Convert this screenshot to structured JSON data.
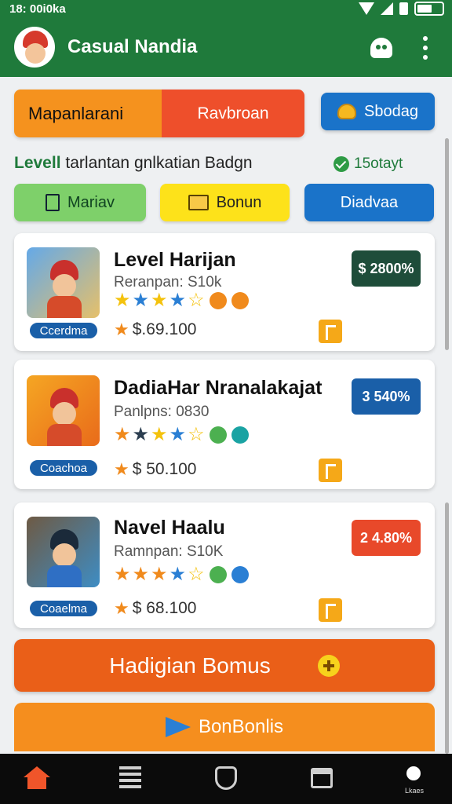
{
  "status_bar": {
    "time": "18: 00i0ka"
  },
  "app": {
    "title": "Casual Nandia"
  },
  "segment": {
    "left_label": "Mapanlarani",
    "right_label": "Ravbroan"
  },
  "top_button": {
    "label": "Sbodag"
  },
  "level_line": {
    "level": "Levell",
    "text": "tarlantan gnlkatian Badgn",
    "status": "15otayt"
  },
  "chips": [
    {
      "label": "Mariav"
    },
    {
      "label": "Bonun"
    },
    {
      "label": "Diadvaa"
    }
  ],
  "cards": [
    {
      "title": "Level Harijan",
      "subtitle": "Reranpan: S10k",
      "badge": "Ccerdma",
      "price": "$.69.100",
      "tag": "$ 2800%",
      "rating": 4
    },
    {
      "title": "DadiaHar Nranalakajat",
      "subtitle": "Panlpns: 0830",
      "badge": "Coachoa",
      "price": "$ 50.100",
      "tag": "3 540%",
      "rating": 4
    },
    {
      "title": "Navel Haalu",
      "subtitle": "Ramnpan: S10K",
      "badge": "Coaelma",
      "price": "$ 68.100",
      "tag": "2 4.80%",
      "rating": 4
    }
  ],
  "big_button": {
    "label": "Hadigian Bomus"
  },
  "bonus_button": {
    "label": "BonBonlis"
  },
  "nav": {
    "profile_label": "Lkaes"
  },
  "colors": {
    "primary_green": "#1f7a3b",
    "accent_orange": "#ea5f18",
    "accent_blue": "#1a73c9"
  }
}
